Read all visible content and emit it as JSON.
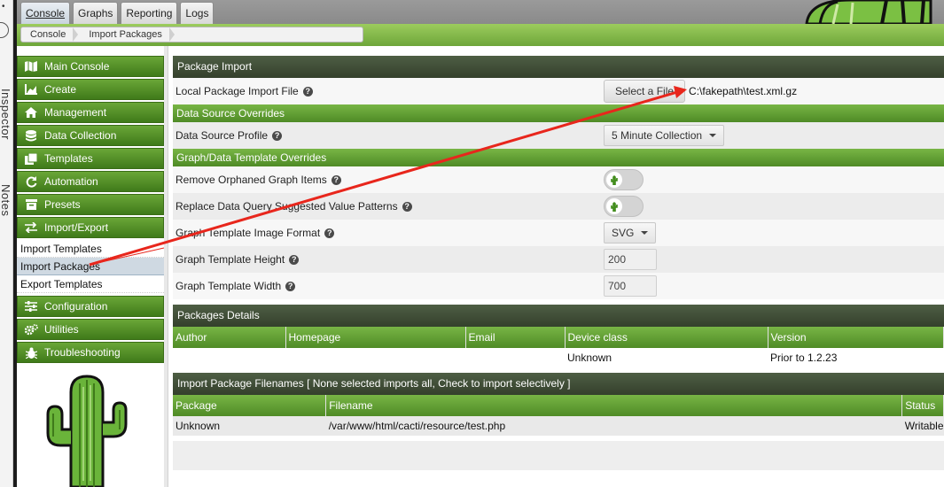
{
  "inspector": {
    "label1": "Inspector",
    "label2": "Notes",
    "dot": "•"
  },
  "tabs": [
    {
      "label": "Console",
      "active": true
    },
    {
      "label": "Graphs"
    },
    {
      "label": "Reporting"
    },
    {
      "label": "Logs"
    }
  ],
  "breadcrumb": [
    "Console",
    "Import Packages"
  ],
  "nav": {
    "items": [
      {
        "label": "Main Console",
        "icon": "map-icon"
      },
      {
        "label": "Create",
        "icon": "chart-icon"
      },
      {
        "label": "Management",
        "icon": "home-icon"
      },
      {
        "label": "Data Collection",
        "icon": "database-icon"
      },
      {
        "label": "Templates",
        "icon": "copy-icon"
      },
      {
        "label": "Automation",
        "icon": "refresh-icon"
      },
      {
        "label": "Presets",
        "icon": "archive-icon"
      },
      {
        "label": "Import/Export",
        "icon": "exchange-icon"
      }
    ],
    "subitems": [
      "Import Templates",
      "Import Packages",
      "Export Templates"
    ],
    "items2": [
      {
        "label": "Configuration",
        "icon": "sliders-icon"
      },
      {
        "label": "Utilities",
        "icon": "gears-icon"
      },
      {
        "label": "Troubleshooting",
        "icon": "bug-icon"
      }
    ]
  },
  "main": {
    "header": "Package Import",
    "local_file": {
      "label": "Local Package Import File",
      "button": "Select a File",
      "path": "C:\\fakepath\\test.xml.gz"
    },
    "ds_overrides": "Data Source Overrides",
    "ds_profile": {
      "label": "Data Source Profile",
      "value": "5 Minute Collection"
    },
    "graph_overrides": "Graph/Data Template Overrides",
    "remove_orphans": {
      "label": "Remove Orphaned Graph Items"
    },
    "replace_patterns": {
      "label": "Replace Data Query Suggested Value Patterns"
    },
    "image_format": {
      "label": "Graph Template Image Format",
      "value": "SVG"
    },
    "height": {
      "label": "Graph Template Height",
      "value": "200"
    },
    "width": {
      "label": "Graph Template Width",
      "value": "700"
    },
    "packages_details": {
      "title": "Packages Details",
      "columns": [
        "Author",
        "Homepage",
        "Email",
        "Device class",
        "Version"
      ],
      "row": [
        "",
        "",
        "",
        "Unknown",
        "Prior to 1.2.23"
      ]
    },
    "filenames": {
      "title": "Import Package Filenames [ None selected imports all, Check to import selectively ]",
      "columns": [
        "Package",
        "Filename",
        "Status"
      ],
      "row": [
        "Unknown",
        "/var/www/html/cacti/resource/test.php",
        "Writable"
      ]
    }
  },
  "colors": {
    "accent_green": "#5c9a2d",
    "header_dark": "#3d4a34",
    "arrow": "#e8261c"
  }
}
